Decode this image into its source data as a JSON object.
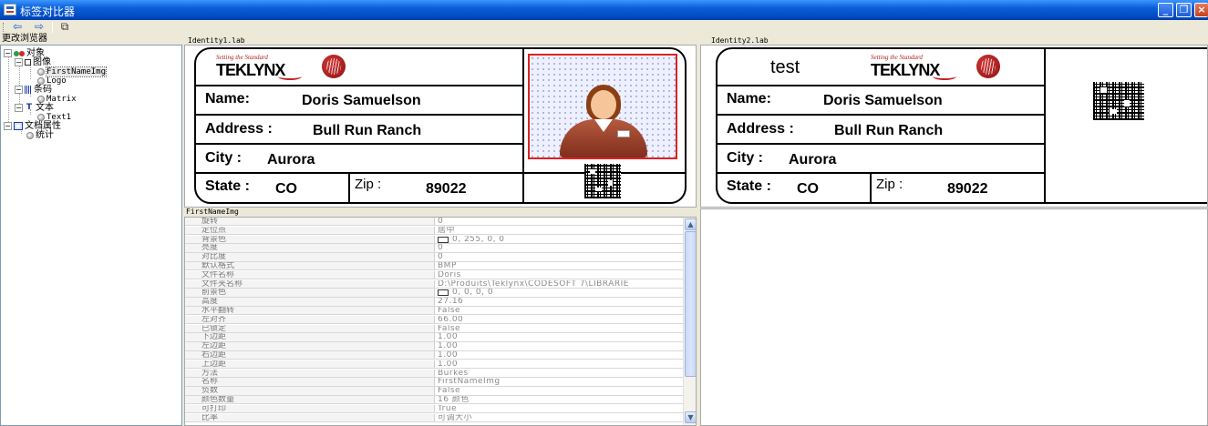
{
  "window": {
    "title": "标签对比器"
  },
  "toolbar": {
    "back": "⇦",
    "forward": "⇨",
    "compare": "⧉"
  },
  "tree": {
    "header": "更改浏览器",
    "items": [
      {
        "label": "对象",
        "icon": "object-icon"
      },
      {
        "label": "图像",
        "icon": "image-icon"
      },
      {
        "label": "FirstNameImg",
        "icon": "node-icon"
      },
      {
        "label": "Logo",
        "icon": "node-icon"
      },
      {
        "label": "条码",
        "icon": "barcode-icon"
      },
      {
        "label": "Matrix",
        "icon": "node-icon"
      },
      {
        "label": "文本",
        "icon": "text-icon"
      },
      {
        "label": "Text1",
        "icon": "node-icon"
      },
      {
        "label": "文档属性",
        "icon": "document-icon"
      },
      {
        "label": "统计",
        "icon": "node-icon"
      }
    ]
  },
  "label1": {
    "filename": "Identity1.lab",
    "logo": {
      "tagline": "Setting the Standard",
      "word": "TEKLYNX"
    },
    "name_label": "Name:",
    "name_value": "Doris Samuelson",
    "address_label": "Address :",
    "address_value": "Bull Run Ranch",
    "city_label": "City :",
    "city_value": "Aurora",
    "state_label": "State :",
    "state_value": "CO",
    "zip_label": "Zip :",
    "zip_value": "89022"
  },
  "label2": {
    "filename": "Identity2.lab",
    "first_text": "test",
    "logo": {
      "tagline": "Setting the Standard",
      "word": "TEKLYNX"
    },
    "name_label": "Name:",
    "name_value": "Doris Samuelson",
    "address_label": "Address :",
    "address_value": "Bull Run Ranch",
    "city_label": "City :",
    "city_value": "Aurora",
    "state_label": "State :",
    "state_value": "CO",
    "zip_label": "Zip :",
    "zip_value": "89022"
  },
  "properties": {
    "header": "FirstNameImg",
    "rows": [
      {
        "name": "旋转",
        "value": "0"
      },
      {
        "name": "定位点",
        "value": "居中"
      },
      {
        "name": "背景色",
        "value": "0, 255, 0, 0",
        "swatch": true
      },
      {
        "name": "亮度",
        "value": "0"
      },
      {
        "name": "对比度",
        "value": "0"
      },
      {
        "name": "默认格式",
        "value": "BMP"
      },
      {
        "name": "文件名称",
        "value": "Doris"
      },
      {
        "name": "文件夹名称",
        "value": "D:\\Produits\\Teklynx\\CODESOFT 7\\LIBRARIE"
      },
      {
        "name": "前景色",
        "value": "0, 0, 0, 0",
        "swatch": true
      },
      {
        "name": "高度",
        "value": "27.16"
      },
      {
        "name": "水平翻转",
        "value": "False"
      },
      {
        "name": "左对齐",
        "value": "66.00"
      },
      {
        "name": "已锁定",
        "value": "False"
      },
      {
        "name": "下边距",
        "value": "1.00"
      },
      {
        "name": "左边距",
        "value": "1.00"
      },
      {
        "name": "右边距",
        "value": "1.00"
      },
      {
        "name": "上边距",
        "value": "1.00"
      },
      {
        "name": "方法",
        "value": "Burkes"
      },
      {
        "name": "名称",
        "value": "FirstNameImg"
      },
      {
        "name": "负数",
        "value": "False"
      },
      {
        "name": "颜色数量",
        "value": "16 颜色"
      },
      {
        "name": "可打印",
        "value": "True"
      },
      {
        "name": "比率",
        "value": "可调大小"
      }
    ]
  },
  "colors": {
    "titlebar": "#0a5fd8",
    "photo_border": "#dd2222",
    "brand_red": "#b01d1d"
  }
}
